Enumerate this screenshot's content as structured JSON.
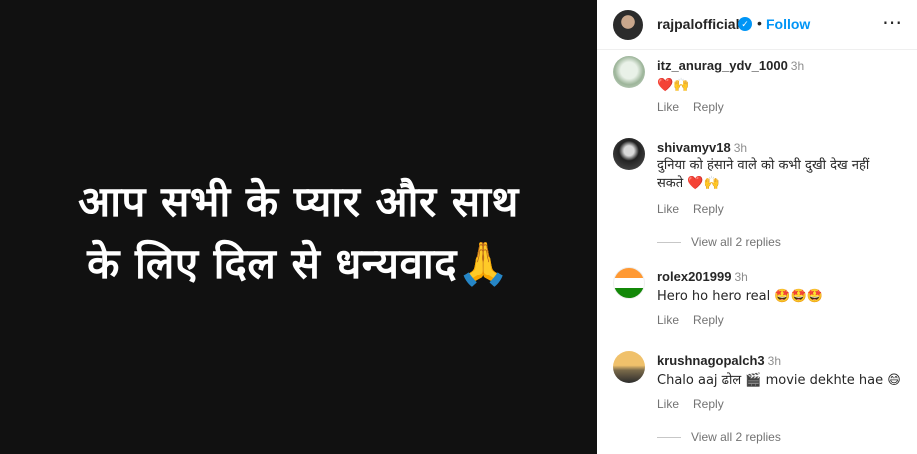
{
  "post": {
    "media_text_line1": "आप सभी के प्यार और साथ",
    "media_text_line2": "के लिए दिल से धन्यवाद🙏"
  },
  "header": {
    "username": "rajpalofficial",
    "separator": "•",
    "follow_label": "Follow",
    "more_icon": "⋯"
  },
  "comments": [
    {
      "username": "itz_anurag_ydv_1000",
      "time": "3h",
      "text": "❤️🙌",
      "like_label": "Like",
      "reply_label": "Reply"
    },
    {
      "username": "shivamyv18",
      "time": "3h",
      "text_line1": "दुनिया को हंसाने वाले को कभी दुखी देख नहीं",
      "text_line2": "सकते ❤️🙌",
      "like_label": "Like",
      "reply_label": "Reply",
      "view_replies": "View all 2 replies"
    },
    {
      "username": "rolex201999",
      "time": "3h",
      "text": "Hero ho hero real 🤩🤩🤩",
      "like_label": "Like",
      "reply_label": "Reply"
    },
    {
      "username": "krushnagopalch3",
      "time": "3h",
      "text": "Chalo aaj ढोल 🎬 movie dekhte hae 😄",
      "like_label": "Like",
      "reply_label": "Reply",
      "view_replies": "View all 2 replies"
    }
  ],
  "colors": {
    "accent": "#0095f6",
    "media_bg": "#111111",
    "secondary_text": "#737373"
  }
}
